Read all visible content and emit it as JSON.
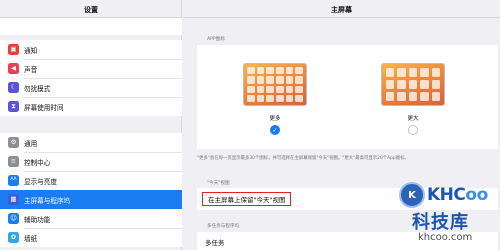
{
  "sidebar": {
    "title": "设置",
    "groups": [
      [
        {
          "label": "通知",
          "icon": "bell-icon",
          "color": "#ef3b36",
          "glyph": "▣"
        },
        {
          "label": "声音",
          "icon": "speaker-icon",
          "color": "#ef3b55",
          "glyph": "◀"
        },
        {
          "label": "勿扰模式",
          "icon": "moon-icon",
          "color": "#5b55d6",
          "glyph": "☾"
        },
        {
          "label": "屏幕使用时间",
          "icon": "hourglass-icon",
          "color": "#5b55d6",
          "glyph": "⧗"
        }
      ],
      [
        {
          "label": "通用",
          "icon": "gear-icon",
          "color": "#8e8e93",
          "glyph": "⚙"
        },
        {
          "label": "控制中心",
          "icon": "control-center-icon",
          "color": "#8e8e93",
          "glyph": "≡"
        },
        {
          "label": "显示与亮度",
          "icon": "brightness-icon",
          "color": "#1a7cf2",
          "glyph": "AA"
        },
        {
          "label": "主屏幕与程序坞",
          "icon": "home-grid-icon",
          "color": "#3f5bd8",
          "glyph": "▦",
          "selected": true
        },
        {
          "label": "辅助功能",
          "icon": "accessibility-icon",
          "color": "#1a7cf2",
          "glyph": "☺"
        },
        {
          "label": "墙纸",
          "icon": "wallpaper-icon",
          "color": "#2fa7e8",
          "glyph": "✿"
        }
      ]
    ]
  },
  "detail": {
    "title": "主屏幕",
    "app_icons_header": "APP图标",
    "options": [
      {
        "label": "更多",
        "selected": true
      },
      {
        "label": "更大",
        "selected": false
      }
    ],
    "footnote": "\"更多\"会在每一页显示最多30个图标，并可选择在主屏幕保留\"今天\"视图。\"更大\"最高可显示20个App图标。",
    "today_header": "\"今天\"视图",
    "today_row_label": "在主屏幕上保留\"今天\"视图",
    "multitask_header": "多任务与程序坞",
    "multitask_label": "多任务"
  },
  "watermark": {
    "brand_prefix": "KHC",
    "brand_suffix": "oo",
    "stamp": "K",
    "cn": "科技库",
    "url": "khcoo.com"
  }
}
